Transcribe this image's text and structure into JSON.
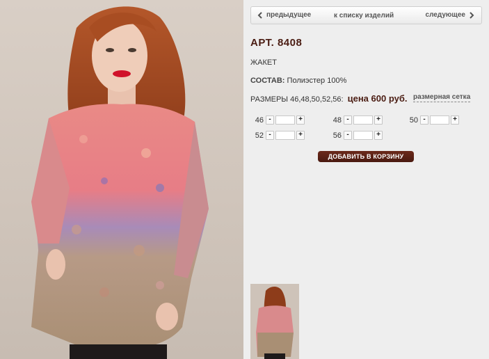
{
  "nav": {
    "prev_label": "предыдущее",
    "list_label": "к списку изделий",
    "next_label": "следующее"
  },
  "product": {
    "article": "АРТ. 8408",
    "type": "ЖАКЕТ",
    "composition_label": "СОСТАВ:",
    "composition_value": "Полиэстер 100%",
    "sizes_text": "РАЗМЕРЫ 46,48,50,52,56:",
    "price_text": "цена 600 руб.",
    "size_chart_label": "размерная сетка"
  },
  "quantities": [
    {
      "size": "46",
      "minus": "-",
      "plus": "+"
    },
    {
      "size": "48",
      "minus": "-",
      "plus": "+"
    },
    {
      "size": "50",
      "minus": "-",
      "plus": "+"
    },
    {
      "size": "52",
      "minus": "-",
      "plus": "+"
    },
    {
      "size": "56",
      "minus": "-",
      "plus": "+"
    }
  ],
  "add_to_cart_label": "ДОБАВИТЬ В КОРЗИНУ",
  "colors": {
    "brand_brown": "#4a1c12",
    "background": "#eeeeee"
  },
  "icons": {
    "prev": "chevron-left-icon",
    "next": "chevron-right-icon"
  }
}
